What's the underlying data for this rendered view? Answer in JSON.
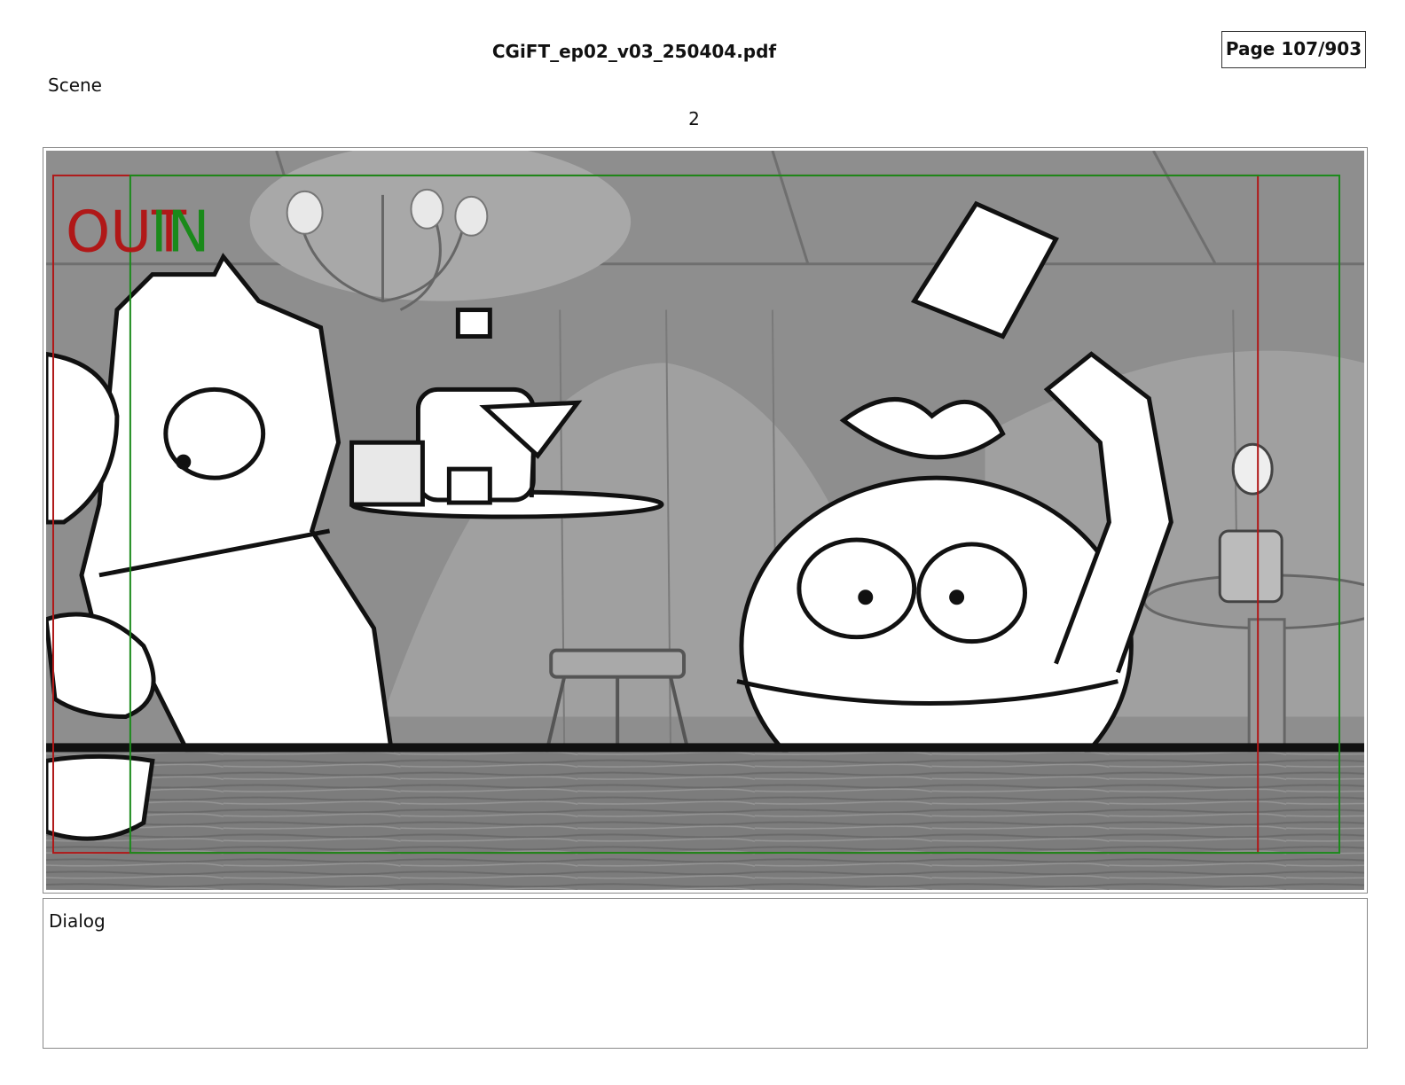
{
  "header": {
    "file_name": "CGiFT_ep02_v03_250404.pdf",
    "page_indicator": "Page 107/903"
  },
  "scene": {
    "label": "Scene",
    "number": "2"
  },
  "panel": {
    "marker_out": "OUT",
    "marker_in": "IN",
    "colors": {
      "out_frame": "#b01818",
      "in_frame": "#1a8a1a",
      "background": "#8e8e8e",
      "counter": "#7a7a7a"
    }
  },
  "dialog": {
    "label": "Dialog"
  }
}
